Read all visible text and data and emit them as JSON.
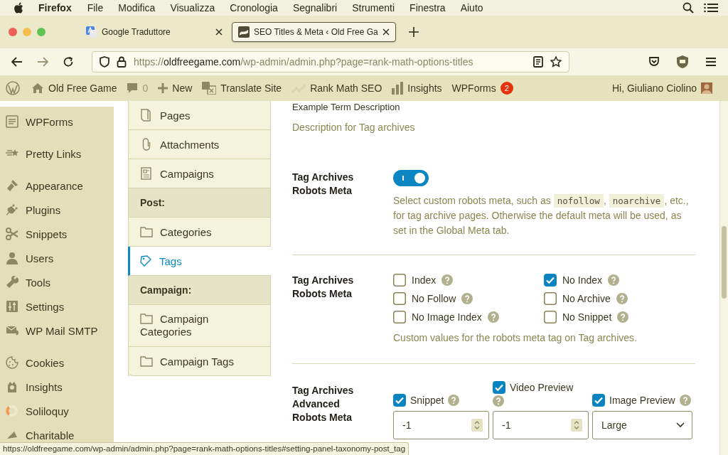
{
  "menubar": {
    "app": "Firefox",
    "items": [
      "File",
      "Modifica",
      "Visualizza",
      "Cronologia",
      "Segnalibri",
      "Strumenti",
      "Finestra",
      "Aiuto"
    ]
  },
  "browser": {
    "tabs": [
      {
        "title": "Google Traduttore",
        "selected": false
      },
      {
        "title": "SEO Titles & Meta ‹ Old Free Ga",
        "selected": true
      }
    ],
    "url": {
      "scheme": "https://",
      "host": "oldfreegame.com",
      "path": "/wp-admin/admin.php?page=rank-math-options-titles"
    }
  },
  "admin_bar": {
    "site": "Old Free Game",
    "comments": "0",
    "new": "New",
    "translate": "Translate Site",
    "rank_math": "Rank Math SEO",
    "insights": "Insights",
    "wpforms": "WPForms",
    "wpforms_count": "2",
    "greeting": "Hi, Giuliano Ciolino"
  },
  "sidebar": {
    "groups": [
      [
        "WPForms"
      ],
      [
        "Pretty Links"
      ],
      [
        "Appearance",
        "Plugins",
        "Snippets",
        "Users",
        "Tools",
        "Settings",
        "WP Mail SMTP"
      ],
      [
        "Cookies",
        "Insights",
        "Soliloquy",
        "Charitable"
      ]
    ]
  },
  "tax_nav": {
    "items": [
      {
        "kind": "item",
        "label": "Pages",
        "selected": false
      },
      {
        "kind": "item",
        "label": "Attachments",
        "selected": false
      },
      {
        "kind": "item",
        "label": "Campaigns",
        "selected": false
      },
      {
        "kind": "heading",
        "label": "Post:"
      },
      {
        "kind": "item",
        "label": "Categories",
        "selected": false
      },
      {
        "kind": "item",
        "label": "Tags",
        "selected": true
      },
      {
        "kind": "heading",
        "label": "Campaign:"
      },
      {
        "kind": "item",
        "label": "Campaign Categories",
        "selected": false
      },
      {
        "kind": "item",
        "label": "Campaign Tags",
        "selected": false
      }
    ]
  },
  "settings": {
    "field_value": "Example Term Description",
    "field_description": "Description for Tag archives",
    "sections": [
      {
        "kind": "toggle",
        "label": "Tag Archives Robots Meta",
        "on": true,
        "description": [
          {
            "text": "Select custom robots meta, such as "
          },
          {
            "code": "nofollow"
          },
          {
            "text": ", "
          },
          {
            "code": "noarchive"
          },
          {
            "text": ", etc., for tag archive pages. Otherwise the default meta will be used, as set in the Global Meta tab."
          }
        ]
      },
      {
        "kind": "checkboxes",
        "label": "Tag Archives Robots Meta",
        "options": [
          {
            "label": "Index",
            "checked": false
          },
          {
            "label": "No Index",
            "checked": true
          },
          {
            "label": "No Follow",
            "checked": false
          },
          {
            "label": "No Archive",
            "checked": false
          },
          {
            "label": "No Image Index",
            "checked": false
          },
          {
            "label": "No Snippet",
            "checked": false
          }
        ],
        "description": "Custom values for the robots meta tag on Tag archives."
      },
      {
        "kind": "advanced",
        "label": "Tag Archives Advanced Robots Meta",
        "options": [
          {
            "kind": "number",
            "label": "Snippet",
            "checked": true,
            "value": "-1"
          },
          {
            "kind": "number",
            "label": "Video Preview",
            "checked": true,
            "value": "-1"
          },
          {
            "kind": "select",
            "label": "Image Preview",
            "checked": true,
            "value": "Large"
          }
        ]
      }
    ]
  },
  "status_url": "https://oldfreegame.com/wp-admin/admin.php?page=rank-math-options-titles#setting-panel-taxonomy-post_tag"
}
